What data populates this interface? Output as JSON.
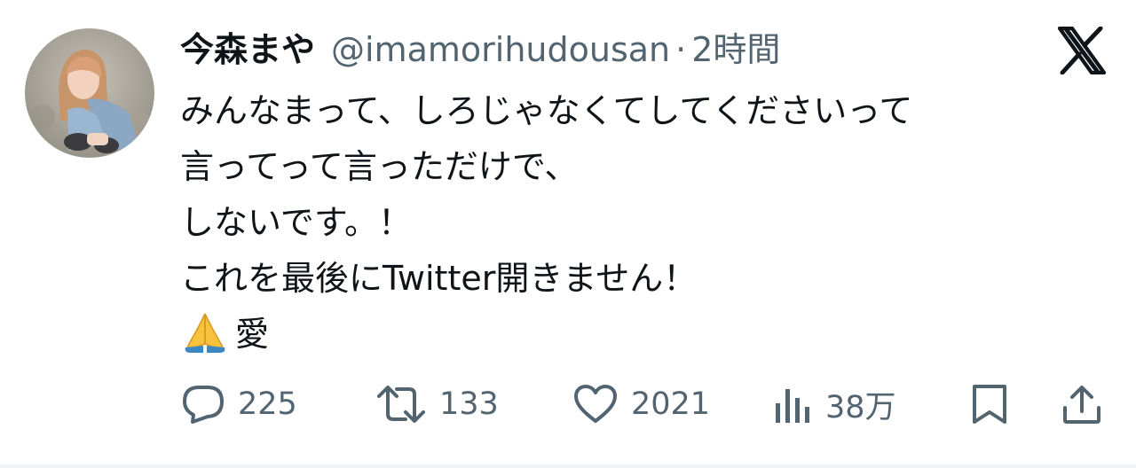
{
  "author": {
    "display_name": "今森まや",
    "handle": "@imamorihudousan",
    "separator": "·",
    "time_ago": "2時間"
  },
  "tweet": {
    "lines": [
      "みんなまって、しろじゃなくてしてくださいって",
      "言ってって言っただけで、",
      "しないです。！",
      "これを最後にTwitter開きません！",
      "愛"
    ],
    "emoji_icon": "folded-hands-icon"
  },
  "actions": {
    "reply_count": "225",
    "retweet_count": "133",
    "like_count": "2021",
    "views_count": "38万"
  },
  "icons": {
    "platform": "x-logo-icon",
    "reply": "reply-icon",
    "retweet": "retweet-icon",
    "like": "heart-icon",
    "views": "views-icon",
    "bookmark": "bookmark-icon",
    "share": "share-icon"
  },
  "colors": {
    "text": "#0f1419",
    "secondary": "#536471",
    "divider": "#eff3f4"
  }
}
